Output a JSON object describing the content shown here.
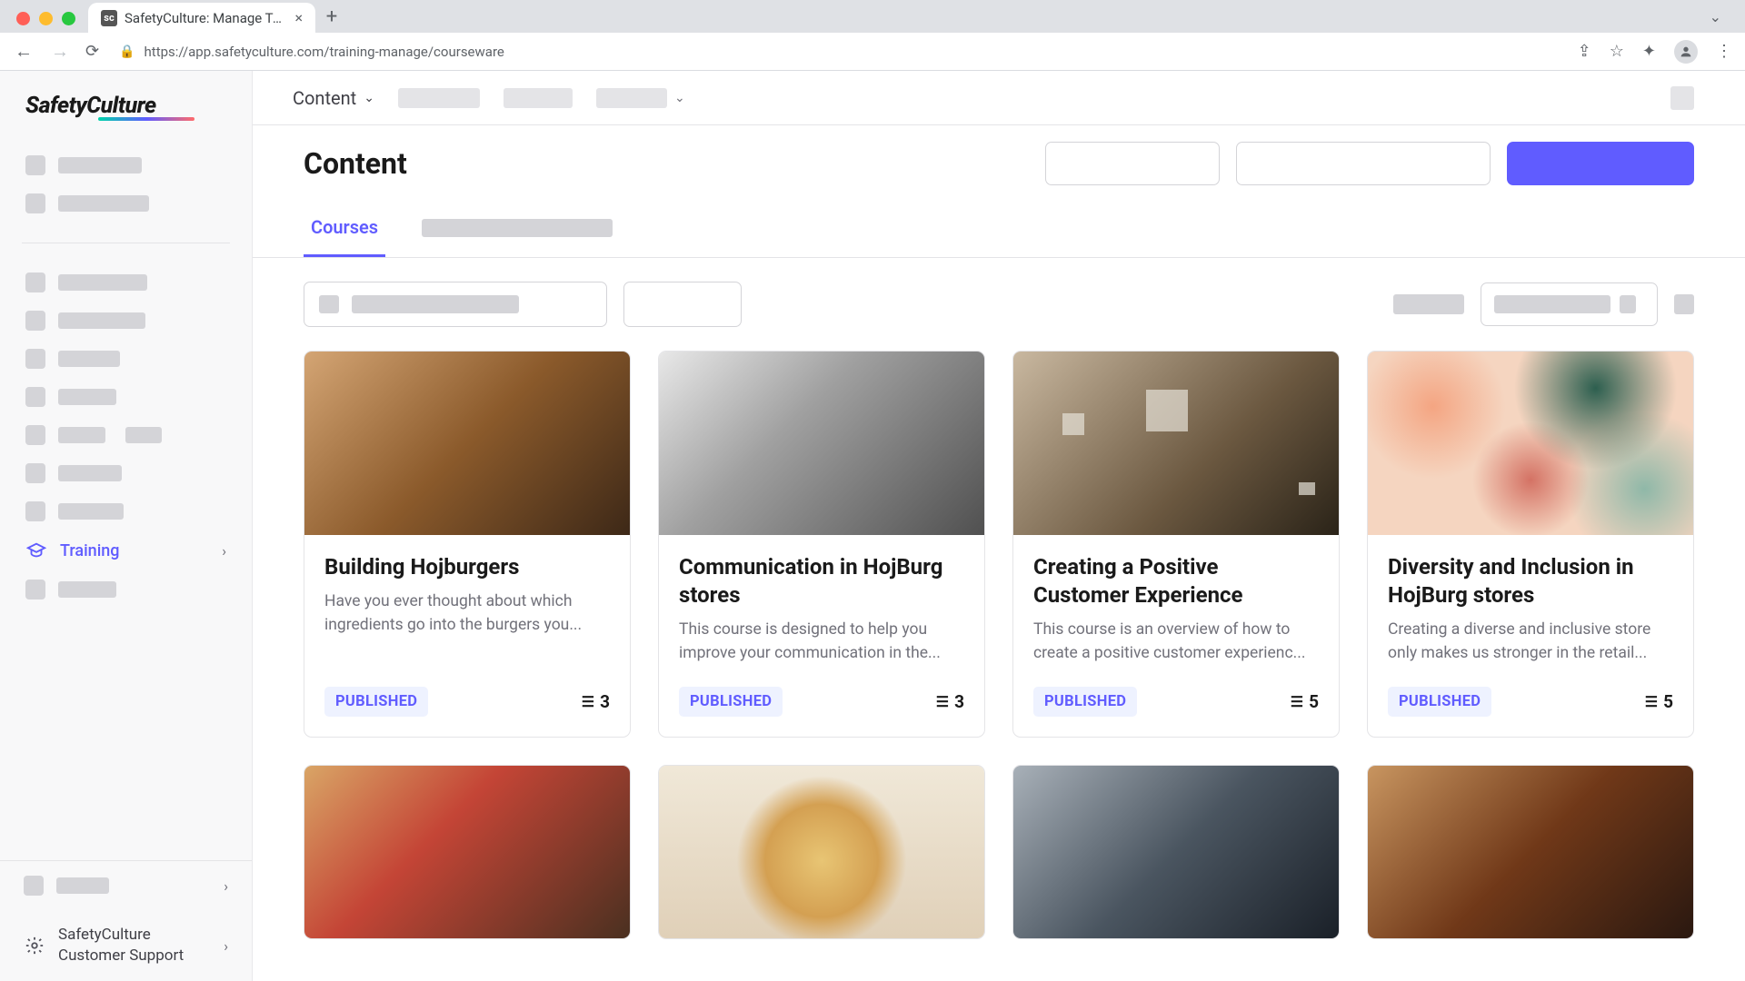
{
  "browser": {
    "tab_title": "SafetyCulture: Manage Teams and ...",
    "url": "https://app.safetyculture.com/training-manage/courseware"
  },
  "logo": "SafetyCulture",
  "sidebar": {
    "training_label": "Training",
    "support_line1": "SafetyCulture",
    "support_line2": "Customer Support"
  },
  "topbar": {
    "content_label": "Content"
  },
  "page_title": "Content",
  "tabs": {
    "courses": "Courses"
  },
  "cards": [
    {
      "title": "Building Hojburgers",
      "desc": "Have you ever thought about which ingredients go into the burgers you...",
      "status": "PUBLISHED",
      "lessons": "3",
      "img": "img-burger1"
    },
    {
      "title": "Communication in HojBurg stores",
      "desc": "This course is designed to help you improve your communication in the...",
      "status": "PUBLISHED",
      "lessons": "3",
      "img": "img-office"
    },
    {
      "title": "Creating a Positive Customer Experience",
      "desc": "This course is an overview of how to create a positive customer experienc...",
      "status": "PUBLISHED",
      "lessons": "5",
      "img": "img-customer"
    },
    {
      "title": "Diversity and Inclusion in HojBurg stores",
      "desc": "Creating a diverse and inclusive store only makes us stronger in the retail...",
      "status": "PUBLISHED",
      "lessons": "5",
      "img": "img-diversity"
    }
  ],
  "cards_row2_imgs": [
    "img-warehouse",
    "img-promo",
    "img-open",
    "img-burger2"
  ]
}
